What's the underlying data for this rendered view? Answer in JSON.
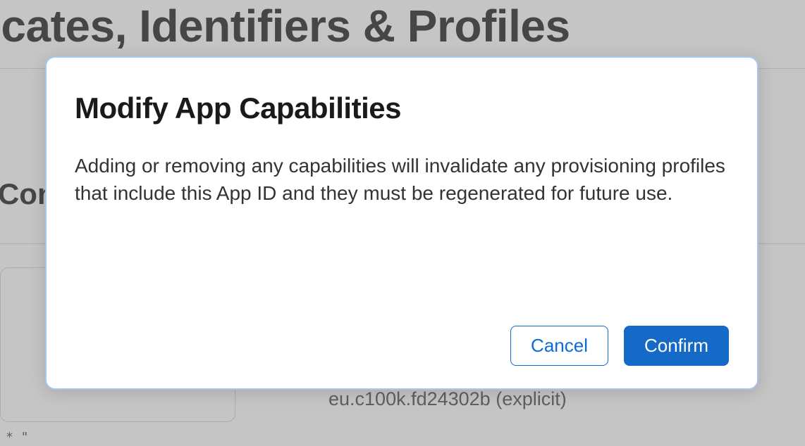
{
  "page": {
    "title": "Certificates, Identifiers & Profiles",
    "section_heading": "App ID Configuration",
    "bundle_id": "eu.c100k.fd24302b (explicit)",
    "small_glyph": "* \""
  },
  "modal": {
    "title": "Modify App Capabilities",
    "body": "Adding or removing any capabilities will invalidate any provisioning profiles that include this App ID and they must be regenerated for future use.",
    "cancel_label": "Cancel",
    "confirm_label": "Confirm"
  }
}
